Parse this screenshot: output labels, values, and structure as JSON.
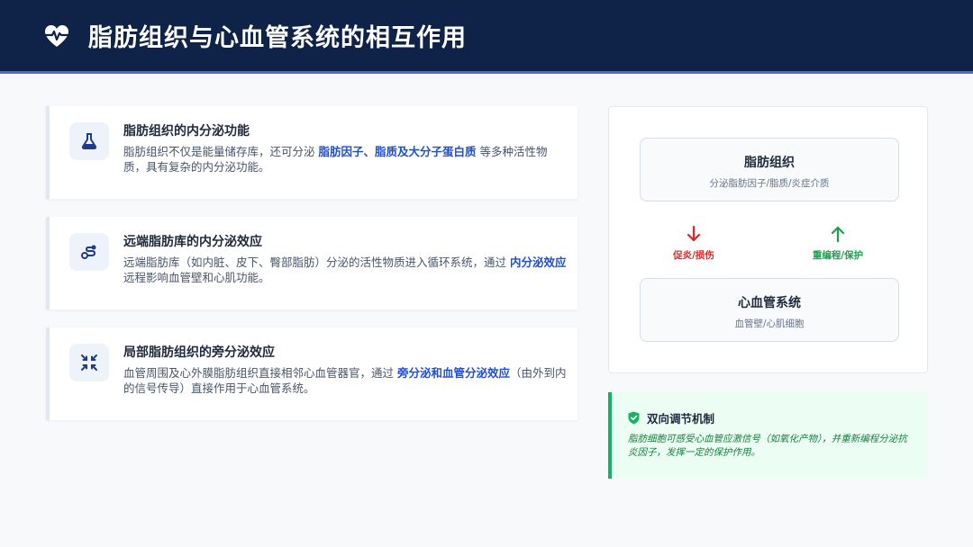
{
  "header": {
    "title": "脂肪组织与心血管系统的相互作用",
    "icon": "heartbeat-icon"
  },
  "cards": [
    {
      "icon": "flask-icon",
      "title": "脂肪组织的内分泌功能",
      "body_pre": "脂肪组织不仅是能量储存库，还可分泌 ",
      "body_hl": "脂肪因子、脂质及大分子蛋白质",
      "body_post": " 等多种活性物质，具有复杂的内分泌功能。"
    },
    {
      "icon": "route-icon",
      "title": "远端脂肪库的内分泌效应",
      "body_pre": "远端脂肪库（如内脏、皮下、臀部脂肪）分泌的活性物质进入循环系统，通过 ",
      "body_hl": "内分泌效应",
      "body_post": " 远程影响血管壁和心肌功能。"
    },
    {
      "icon": "compress-arrows-icon",
      "title": "局部脂肪组织的旁分泌效应",
      "body_pre": "血管周围及心外膜脂肪组织直接相邻心血管器官，通过 ",
      "body_hl": "旁分泌和血管分泌效应",
      "body_post": "（由外到内的信号传导）直接作用于心血管系统。"
    }
  ],
  "diagram": {
    "top_box": {
      "title": "脂肪组织",
      "subtitle": "分泌脂肪因子/脂质/炎症介质"
    },
    "bottom_box": {
      "title": "心血管系统",
      "subtitle": "血管壁/心肌细胞"
    },
    "down_arrow": {
      "label": "促炎/损伤",
      "color": "#dc2626"
    },
    "up_arrow": {
      "label": "重编程/保护",
      "color": "#16a34a"
    }
  },
  "note": {
    "icon": "shield-check-icon",
    "title": "双向调节机制",
    "body": "脂肪细胞可感受心血管应激信号（如氧化产物），并重新编程分泌抗炎因子，发挥一定的保护作用。",
    "accent": "#16b364"
  }
}
